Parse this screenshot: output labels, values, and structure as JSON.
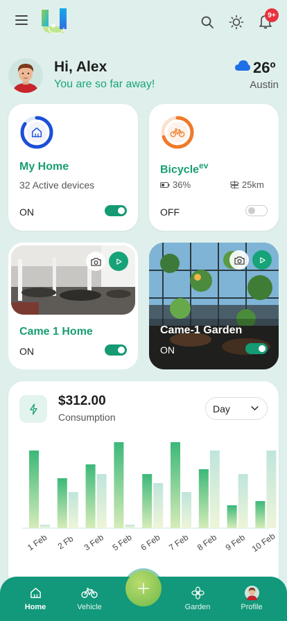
{
  "header": {
    "notification_count": "9+"
  },
  "greeting": {
    "title": "Hi, Alex",
    "subtitle": "You are so far away!"
  },
  "weather": {
    "temperature": "26º",
    "city": "Austin",
    "icon": "cloud-icon"
  },
  "cards": {
    "home": {
      "title": "My Home",
      "subtitle": "32 Active devices",
      "status": "ON",
      "on": true,
      "icon": "house-icon",
      "ring_color": "#1b4fd8"
    },
    "bicycle": {
      "title": "Bicycle",
      "title_sup": "ev",
      "battery": "36%",
      "distance": "25km",
      "status": "OFF",
      "on": false,
      "icon": "bicycle-icon",
      "ring_color": "#f07a2a"
    },
    "camera_home": {
      "title": "Came 1 Home",
      "status": "ON",
      "on": true
    },
    "camera_garden": {
      "title": "Came-1 Garden",
      "status": "ON",
      "on": true
    }
  },
  "consumption": {
    "value": "$312.00",
    "label": "Consumption",
    "period": "Day"
  },
  "chart_data": {
    "type": "bar",
    "categories": [
      "1 Feb",
      "2 Fb",
      "3 Feb",
      "5 Feb",
      "6 Feb",
      "7 Feb",
      "8 Feb",
      "9 Feb",
      "10 Feb"
    ],
    "series": [
      {
        "values": [
          112,
          72,
          92,
          124,
          78,
          124,
          85,
          33,
          39
        ]
      },
      {
        "values": [
          5,
          52,
          78,
          5,
          65,
          52,
          112,
          78,
          112
        ]
      }
    ],
    "colors": [
      "#3cb879",
      "#bfe5dc"
    ],
    "ylim": [
      0,
      130
    ],
    "grid": false,
    "legend": "none"
  },
  "nav": {
    "items": [
      {
        "label": "Home",
        "icon": "home-icon",
        "active": true
      },
      {
        "label": "Vehicle",
        "icon": "bicycle-icon",
        "active": false
      },
      {
        "label": "Garden",
        "icon": "flower-icon",
        "active": false
      },
      {
        "label": "Profile",
        "icon": "avatar-icon",
        "active": false
      }
    ],
    "fab_icon": "plus-icon"
  }
}
